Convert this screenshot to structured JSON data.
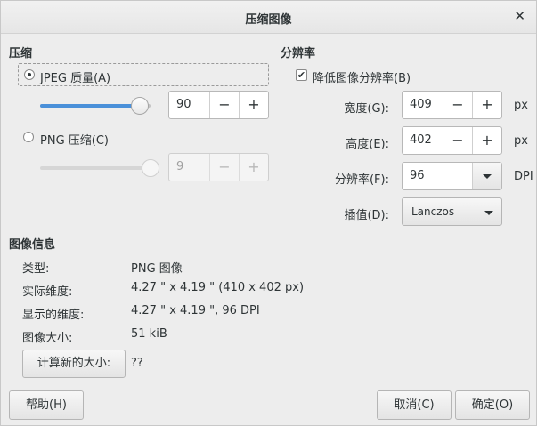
{
  "window": {
    "title": "压缩图像",
    "close_glyph": "✕"
  },
  "compress": {
    "heading": "压缩",
    "jpeg_label": "JPEG 质量(A)",
    "jpeg_value": "90",
    "jpeg_level": 0.9,
    "png_label": "PNG 压缩(C)",
    "png_value": "9",
    "png_level": 1.0,
    "minus": "−",
    "plus": "+"
  },
  "resolution": {
    "heading": "分辨率",
    "reduce_label": "降低图像分辨率(B)",
    "reduce_checked": "✔",
    "width_label": "宽度(G):",
    "width_value": "409",
    "height_label": "高度(E):",
    "height_value": "402",
    "unit_px": "px",
    "dpi_label": "分辨率(F):",
    "dpi_value": "96",
    "dpi_unit": "DPI",
    "interp_label": "插值(D):",
    "interp_value": "Lanczos"
  },
  "info": {
    "heading": "图像信息",
    "rows": [
      {
        "label": "类型:",
        "value": "PNG 图像"
      },
      {
        "label": "实际维度:",
        "value": "4.27 \" x 4.19 \" (410 x 402 px)"
      },
      {
        "label": "显示的维度:",
        "value": "4.27 \" x 4.19 \", 96 DPI"
      },
      {
        "label": "图像大小:",
        "value": "51 kiB"
      }
    ],
    "calc_button": "计算新的大小:",
    "calc_result": "??"
  },
  "footer": {
    "help": "帮助(H)",
    "cancel": "取消(C)",
    "ok": "确定(O)"
  },
  "colors": {
    "accent": "#4a90d9",
    "background": "#ededed"
  }
}
